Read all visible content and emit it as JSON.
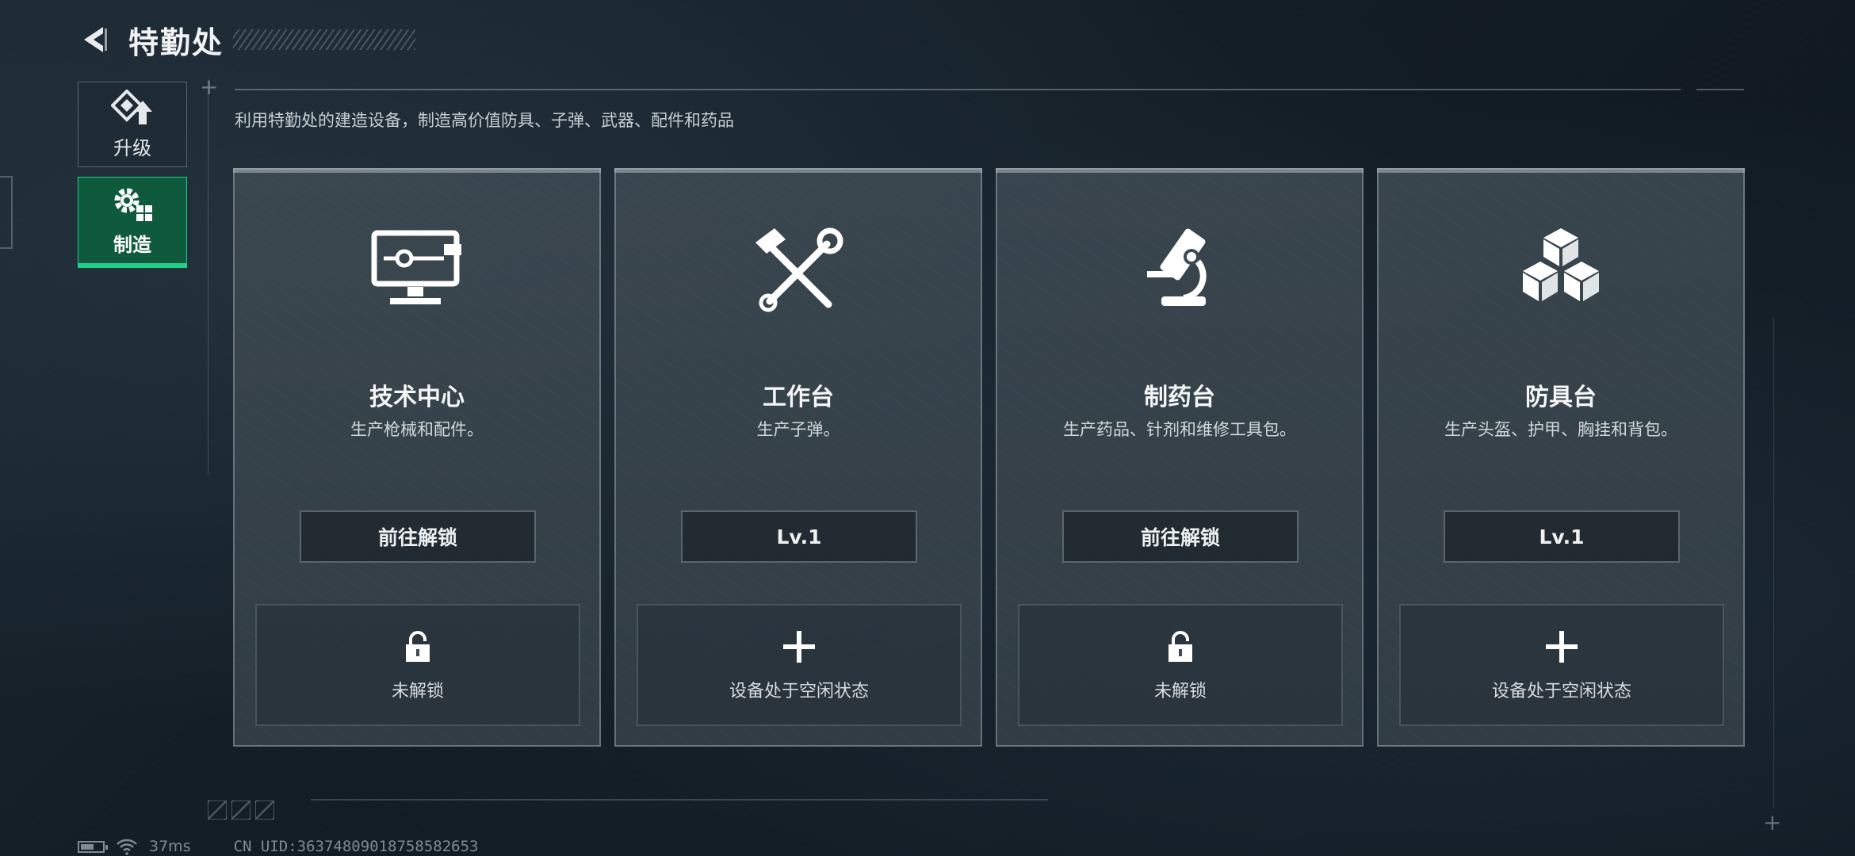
{
  "header": {
    "title": "特勤处",
    "back_icon": "back-arrow-icon"
  },
  "nav": {
    "items": [
      {
        "label": "升级",
        "icon": "upgrade-icon",
        "selected": false
      },
      {
        "label": "制造",
        "icon": "craft-gear-icon",
        "selected": true
      }
    ]
  },
  "subtitle": "利用特勤处的建造设备，制造高价值防具、子弹、武器、配件和药品",
  "colors": {
    "accent_green": "#1ed08a",
    "selected_nav_bg": "#0f5a3c",
    "card_bg": "#3e4a52"
  },
  "stations": [
    {
      "name": "技术中心",
      "description": "生产枪械和配件。",
      "icon": "computer-monitor-icon",
      "button_label": "前往解锁",
      "slot_icon": "lock-icon",
      "slot_label": "未解锁"
    },
    {
      "name": "工作台",
      "description": "生产子弹。",
      "icon": "hammer-wrench-icon",
      "button_label": "Lv.1",
      "slot_icon": "plus-icon",
      "slot_label": "设备处于空闲状态"
    },
    {
      "name": "制药台",
      "description": "生产药品、针剂和维修工具包。",
      "icon": "microscope-icon",
      "button_label": "前往解锁",
      "slot_icon": "lock-icon",
      "slot_label": "未解锁"
    },
    {
      "name": "防具台",
      "description": "生产头盔、护甲、胸挂和背包。",
      "icon": "armor-cubes-icon",
      "button_label": "Lv.1",
      "slot_icon": "plus-icon",
      "slot_label": "设备处于空闲状态"
    }
  ],
  "status_bar": {
    "ping": "37ms",
    "uid": "CN UID:36374809018758582653"
  }
}
